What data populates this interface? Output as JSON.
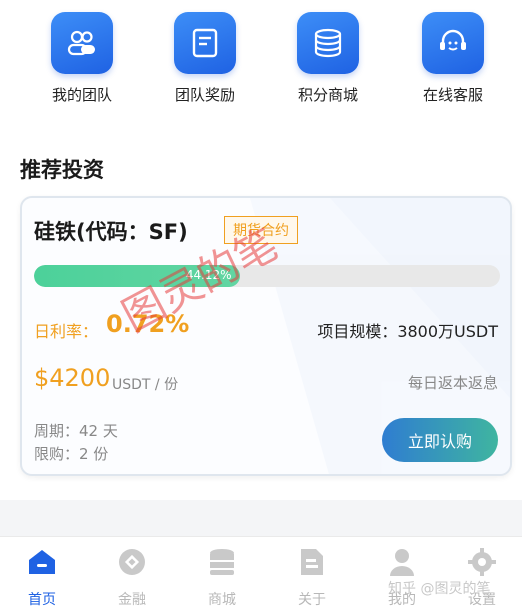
{
  "quick_nav": [
    {
      "label": "我的团队",
      "icon": "team-icon"
    },
    {
      "label": "团队奖励",
      "icon": "reward-icon"
    },
    {
      "label": "积分商城",
      "icon": "points-mall-icon"
    },
    {
      "label": "在线客服",
      "icon": "customer-service-icon"
    }
  ],
  "section_title": "推荐投资",
  "card": {
    "title": "硅铁(代码：SF)",
    "badge": "期货合约",
    "progress_text": "44.12%",
    "progress_value": 44.12,
    "rate_label": "日利率：",
    "rate_value": "0.72%",
    "scale": "项目规模：3800万USDT",
    "price": "$4200",
    "price_unit": "USDT / 份",
    "daily_return": "每日返本返息",
    "cycle": "周期：42 天",
    "limit": "限购：2 份",
    "buy_button": "立即认购"
  },
  "bottom_nav": [
    {
      "label": "首页",
      "icon": "home-icon",
      "active": true
    },
    {
      "label": "金融",
      "icon": "finance-icon",
      "active": false
    },
    {
      "label": "商城",
      "icon": "mall-icon",
      "active": false
    },
    {
      "label": "关于",
      "icon": "about-icon",
      "active": false
    },
    {
      "label": "我的",
      "icon": "profile-icon",
      "active": false
    },
    {
      "label": "设置",
      "icon": "settings-icon",
      "active": false
    }
  ],
  "watermark": "图灵的笔",
  "watermark_zhihu": "知乎 @图灵的笔",
  "colors": {
    "primary": "#1f62e3",
    "accent": "#f0a020",
    "progress": "#4cd19a"
  }
}
